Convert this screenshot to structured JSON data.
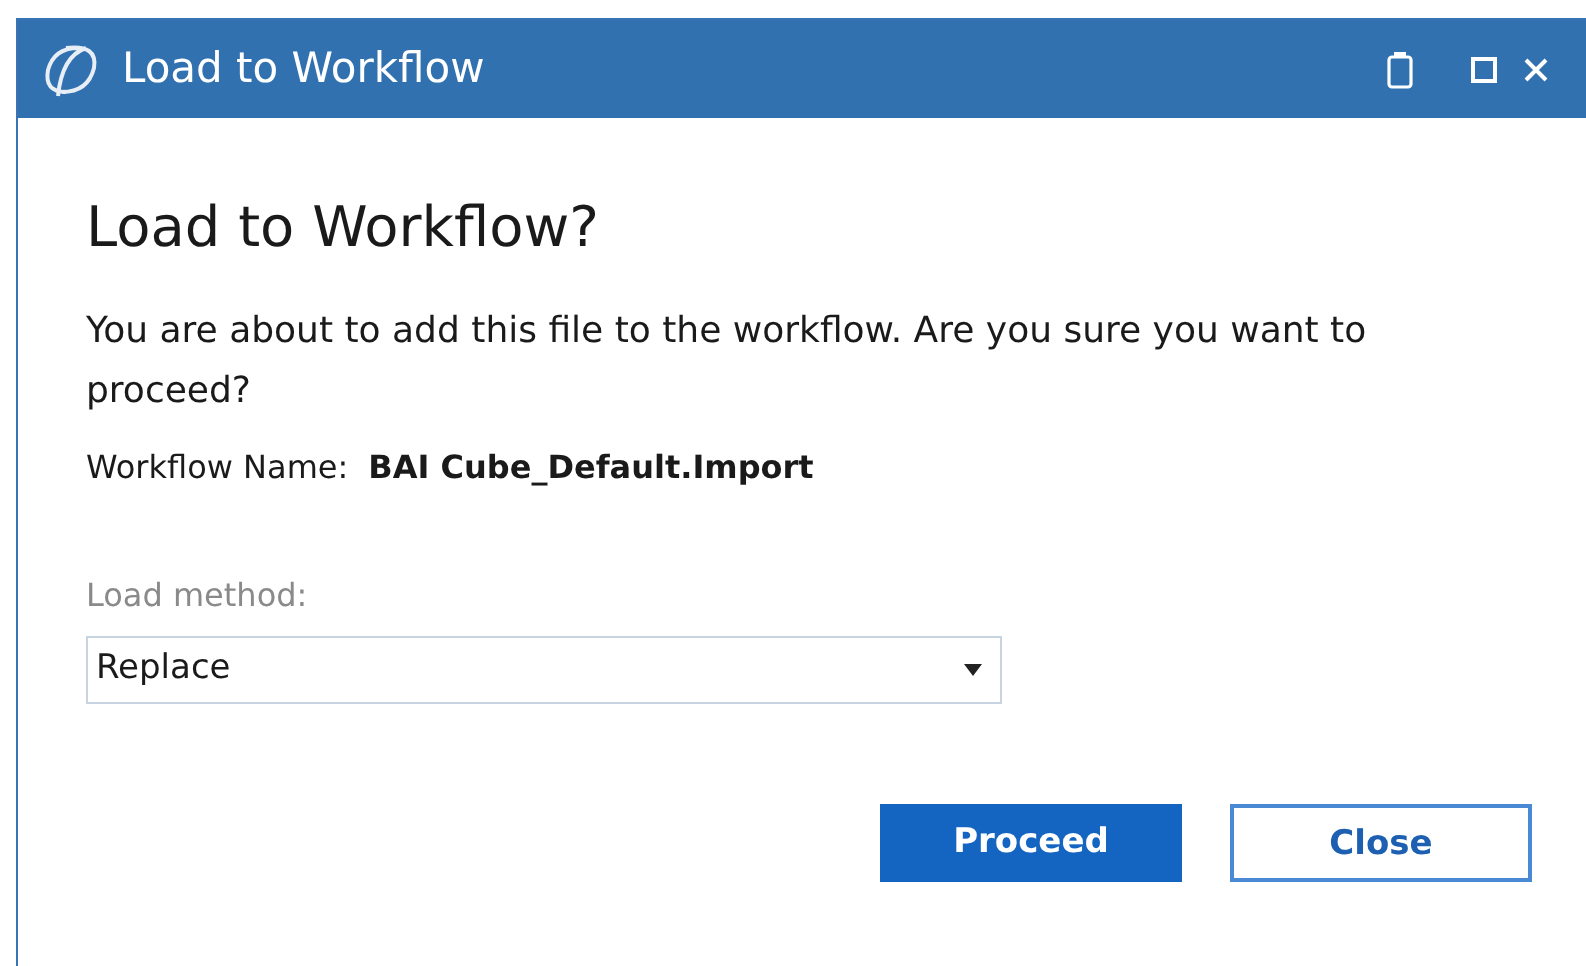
{
  "window": {
    "title": "Load to Workflow"
  },
  "heading": "Load to Workflow?",
  "message": "You are about to add this file to the workflow. Are you sure you want to proceed?",
  "workflow_name": {
    "label": "Workflow Name:",
    "value": "BAI Cube_Default.Import"
  },
  "load_method": {
    "label": "Load method:",
    "value": "Replace"
  },
  "buttons": [
    {
      "label": "Proceed",
      "kind": "primary"
    },
    {
      "label": "Close",
      "kind": "secondary"
    }
  ]
}
